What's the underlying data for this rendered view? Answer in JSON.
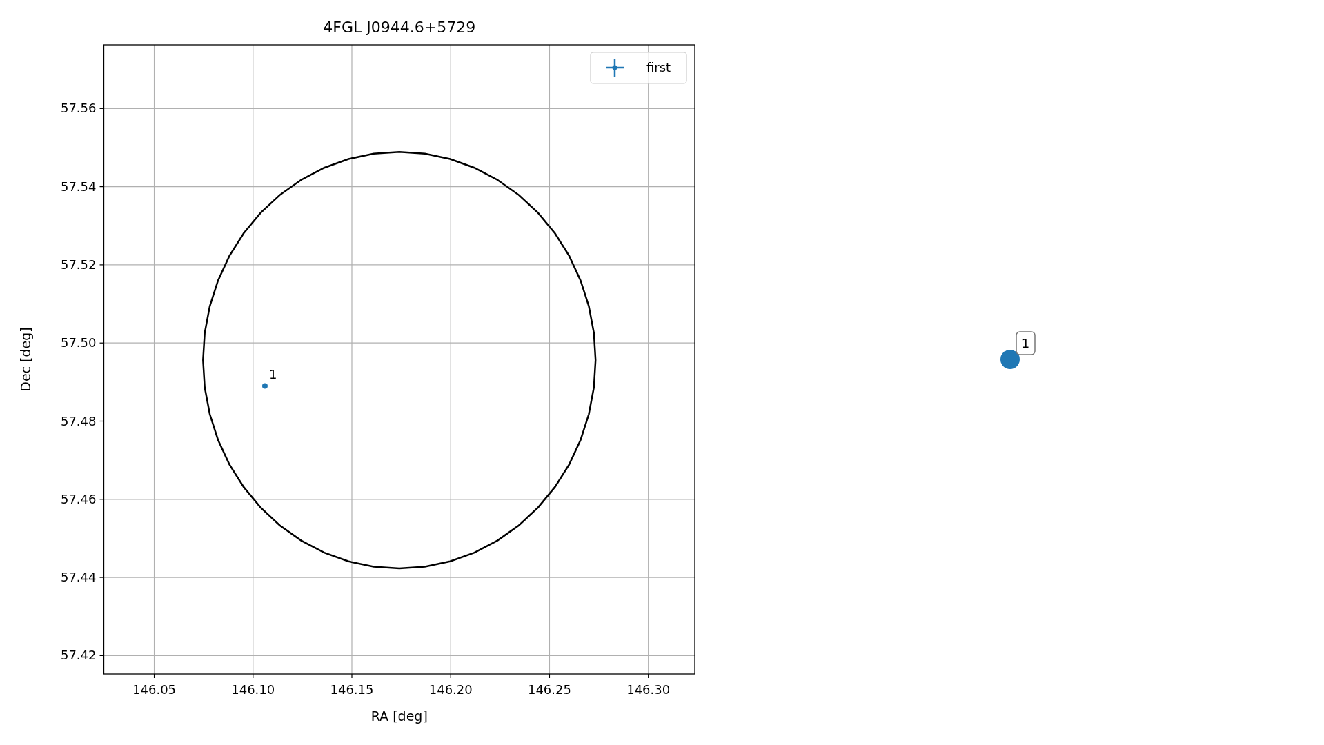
{
  "chart": {
    "chart_data": {
      "type": "line",
      "title": "4FGL J0944.6+5729",
      "xlabel": "RA [deg]",
      "ylabel": "Dec [deg]",
      "series": [
        {
          "name": "first",
          "color": "#1f77b4",
          "marker": "o",
          "x": [
            146.106
          ],
          "values": [
            57.489
          ]
        }
      ],
      "grid": true,
      "xlim": [
        146.0245,
        146.3235
      ],
      "ylim": [
        57.4153,
        57.5763
      ],
      "xticks": [
        {
          "value": 146.05,
          "label": "146.05"
        },
        {
          "value": 146.1,
          "label": "146.10"
        },
        {
          "value": 146.15,
          "label": "146.15"
        },
        {
          "value": 146.2,
          "label": "146.20"
        },
        {
          "value": 146.25,
          "label": "146.25"
        },
        {
          "value": 146.3,
          "label": "146.30"
        }
      ],
      "yticks": [
        {
          "value": 57.42,
          "label": "57.42"
        },
        {
          "value": 57.44,
          "label": "57.44"
        },
        {
          "value": 57.46,
          "label": "57.46"
        },
        {
          "value": 57.48,
          "label": "57.48"
        },
        {
          "value": 57.5,
          "label": "57.50"
        },
        {
          "value": 57.52,
          "label": "57.52"
        },
        {
          "value": 57.54,
          "label": "57.54"
        },
        {
          "value": 57.56,
          "label": "57.56"
        }
      ],
      "annotations": [
        {
          "text": "1",
          "x": 146.106,
          "y": 57.489
        }
      ]
    }
  },
  "side_marker": {
    "label": "1",
    "color": "#1f77b4"
  }
}
